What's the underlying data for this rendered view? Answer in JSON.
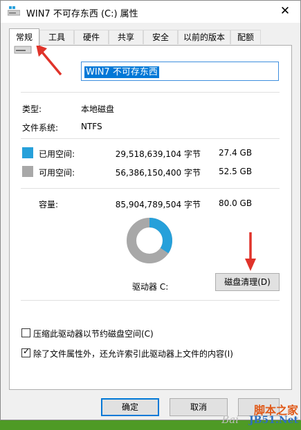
{
  "window": {
    "title": "WIN7 不可存东西 (C:) 属性",
    "close_glyph": "✕"
  },
  "tabs": [
    {
      "label": "常规",
      "active": true
    },
    {
      "label": "工具",
      "active": false
    },
    {
      "label": "硬件",
      "active": false
    },
    {
      "label": "共享",
      "active": false
    },
    {
      "label": "安全",
      "active": false
    },
    {
      "label": "以前的版本",
      "active": false
    },
    {
      "label": "配额",
      "active": false
    }
  ],
  "general": {
    "drive_name": "WIN7 不可存东西",
    "type_label": "类型:",
    "type_value": "本地磁盘",
    "fs_label": "文件系统:",
    "fs_value": "NTFS",
    "used_label": "已用空间:",
    "used_bytes": "29,518,639,104 字节",
    "used_gb": "27.4 GB",
    "free_label": "可用空间:",
    "free_bytes": "56,386,150,400 字节",
    "free_gb": "52.5 GB",
    "capacity_label": "容量:",
    "capacity_bytes": "85,904,789,504 字节",
    "capacity_gb": "80.0 GB",
    "used_fraction": 0.344,
    "drive_label": "驱动器 C:",
    "cleanup_button": "磁盘清理(D)",
    "compress_label": "压缩此驱动器以节约磁盘空间(C)",
    "compress_checked": false,
    "index_label": "除了文件属性外，还允许索引此驱动器上文件的内容(I)",
    "index_checked": true
  },
  "buttons": {
    "ok": "确定",
    "cancel": "取消"
  },
  "colors": {
    "used": "#26a0da",
    "free": "#a8a8a8",
    "arrow": "#e0332a",
    "selection": "#0078d7"
  },
  "watermark": {
    "site": "脚本之家",
    "url": "JB51.Net",
    "baidu": "Bai"
  }
}
